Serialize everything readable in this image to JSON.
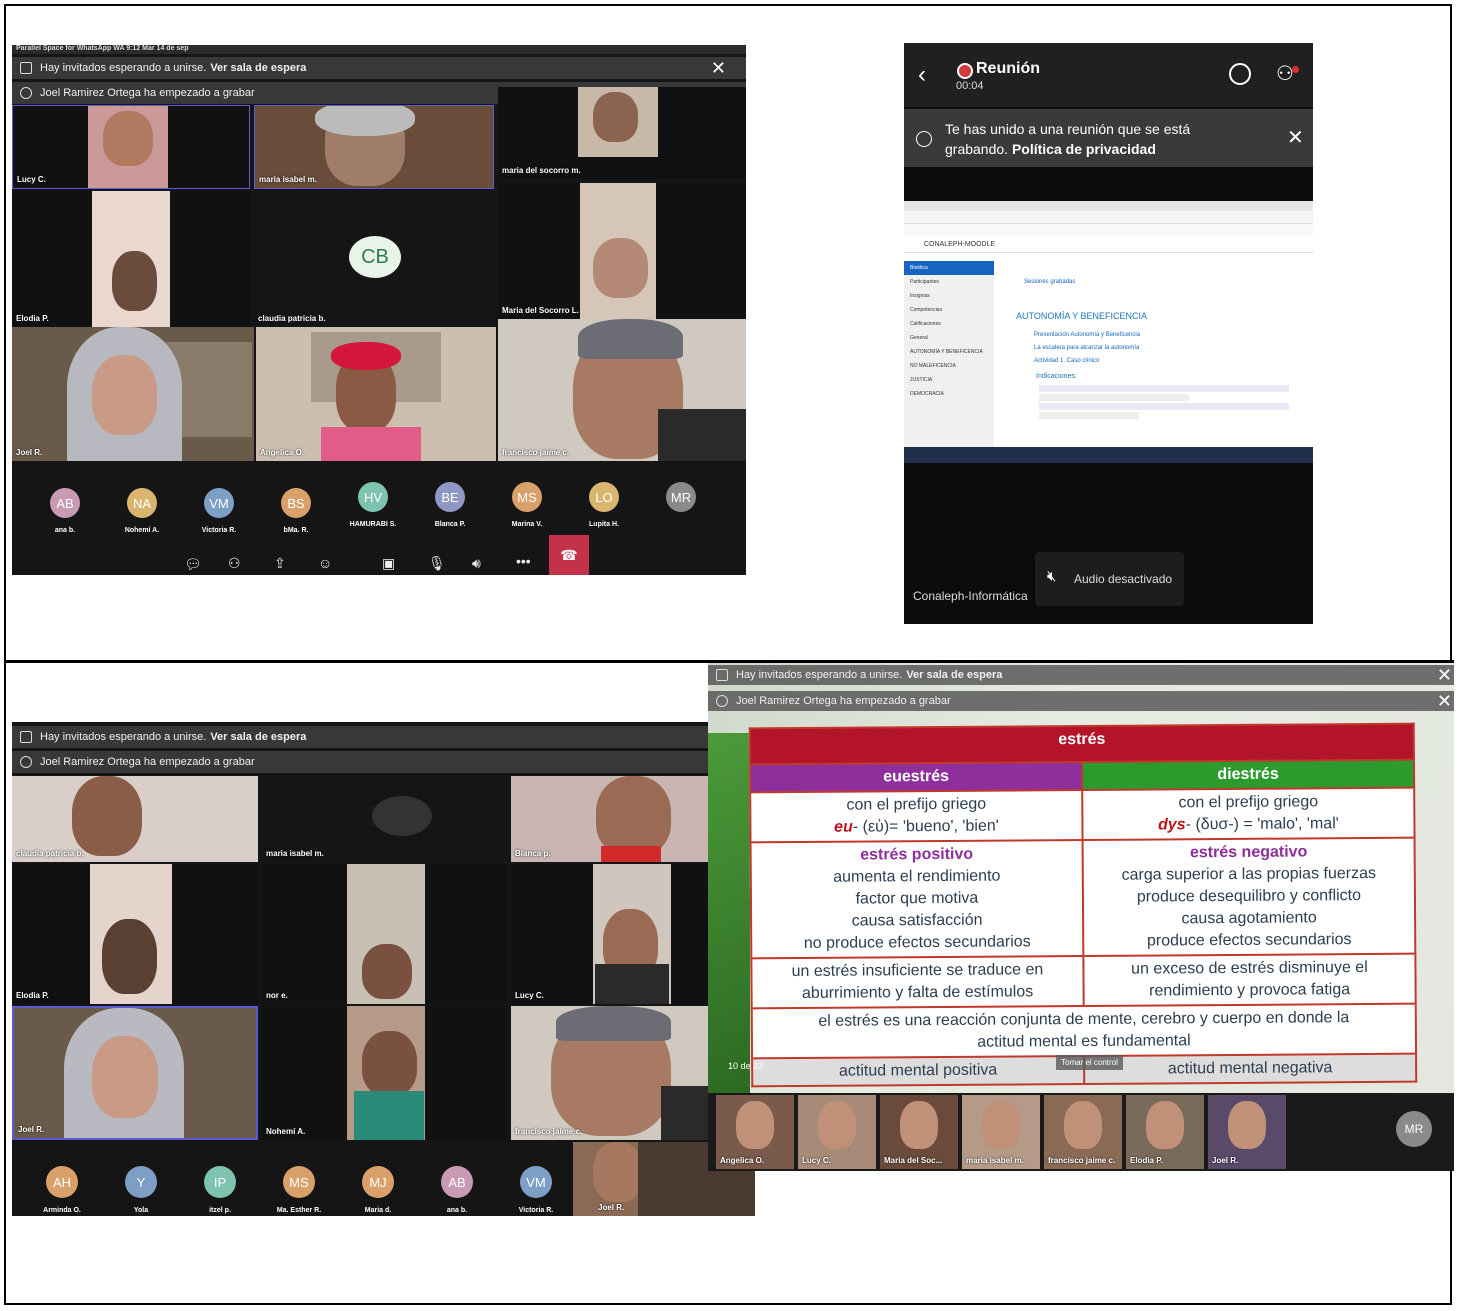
{
  "panel1": {
    "status_bar": "Parallel Space for WhatsApp WA   9:12   Mar 14 de sep",
    "notice_waiting": "Hay invitados esperando a unirse.",
    "notice_waiting_link": "Ver sala de espera",
    "notice_recording": "Joel Ramirez Ortega ha empezado a grabar",
    "tiles": [
      "Lucy C.",
      "maria isabel m.",
      "maria del socorro m.",
      "Elodia P.",
      "claudia patricia b.",
      "Maria del Socorro L.",
      "Joel R.",
      "Angelica O.",
      "francisco jaime c."
    ],
    "center_avatar": "CB",
    "avatars": [
      {
        "initials": "AB",
        "name": "ana b.",
        "color": "#c99ab3"
      },
      {
        "initials": "NA",
        "name": "Nohemí A.",
        "color": "#d9b56f"
      },
      {
        "initials": "VM",
        "name": "Victoria R.",
        "color": "#7d9fc6"
      },
      {
        "initials": "BS",
        "name": "bMa. R.",
        "color": "#d9a06a"
      },
      {
        "initials": "HV",
        "name": "HAMURABI S.",
        "color": "#7ec2b0"
      },
      {
        "initials": "BE",
        "name": "Blanca P.",
        "color": "#8f97c4"
      },
      {
        "initials": "MS",
        "name": "Marina V.",
        "color": "#d9a06a"
      },
      {
        "initials": "LO",
        "name": "Lupita H.",
        "color": "#d9b56f"
      },
      {
        "initials": "MR",
        "name": "",
        "color": "#8a8a8a"
      }
    ]
  },
  "panel2": {
    "title": "Reunión",
    "timer": "00:04",
    "banner_text": "Te has unido a una reunión que se está grabando.",
    "banner_link": "Política de privacidad",
    "moodle_header": "CONALEPH-MOODLE",
    "moodle_sidebar": [
      "Bioética",
      "Participantes",
      "Insignias",
      "Competencias",
      "Calificaciones",
      "General",
      "AUTONOMÍA Y BENEFICENCIA",
      "NO MALEFICENCIA",
      "JUSTICIA",
      "DEMOCRACIA"
    ],
    "moodle_section_link": "Sesiones grabadas",
    "moodle_section_title": "AUTONOMÍA Y BENEFICENCIA",
    "moodle_items": [
      "Presentación Autonomía y Beneficencia",
      "La escalera para alcanzar la autonomía",
      "Actividad 1. Caso clínico"
    ],
    "moodle_indications": "Indicaciones:",
    "audio_off": "Audio desactivado",
    "presenter": "Conaleph-Informática"
  },
  "panel3": {
    "notice_waiting": "Hay invitados esperando a unirse.",
    "notice_waiting_link": "Ver sala de espera",
    "notice_recording": "Joel Ramirez Ortega ha empezado a grabar",
    "tiles": [
      "claudia patricia b.",
      "maria isabel m.",
      "Blanca p.",
      "Elodia P.",
      "nor e.",
      "Lucy C.",
      "Joel R.",
      "Nohemí A.",
      "francisco jaime c."
    ],
    "avatars": [
      {
        "initials": "AH",
        "name": "Arminda O.",
        "color": "#d9a06a"
      },
      {
        "initials": "Y",
        "name": "Yola",
        "color": "#7d9fc6"
      },
      {
        "initials": "IP",
        "name": "itzel p.",
        "color": "#7ec2b0"
      },
      {
        "initials": "MS",
        "name": "Ma. Esther R.",
        "color": "#d9a06a"
      },
      {
        "initials": "MJ",
        "name": "Maria d.",
        "color": "#d9a06a"
      },
      {
        "initials": "AB",
        "name": "ana b.",
        "color": "#c99ab3"
      },
      {
        "initials": "VM",
        "name": "Victoria R.",
        "color": "#7d9fc6"
      }
    ],
    "video_thumb": "Joel R."
  },
  "panel4": {
    "notice_waiting": "Hay invitados esperando a unirse.",
    "notice_waiting_link": "Ver sala de espera",
    "notice_recording": "Joel Ramirez Ortega ha empezado a grabar",
    "slide": {
      "title": "estrés",
      "col_left": "euestrés",
      "col_right": "diestrés",
      "prefix_left_1": "con el prefijo griego",
      "prefix_left_2a": "eu",
      "prefix_left_2b": "- (εὐ)= 'bueno', 'bien'",
      "prefix_right_1": "con el prefijo griego",
      "prefix_right_2a": "dys",
      "prefix_right_2b": "- (δυσ-) = 'malo', 'mal'",
      "left_heading": "estrés positivo",
      "left_lines": [
        "aumenta el rendimiento",
        "factor que motiva",
        "causa satisfacción",
        "no produce efectos secundarios"
      ],
      "right_heading": "estrés negativo",
      "right_lines": [
        "carga superior a las propias fuerzas",
        "produce desequilibro y conflicto",
        "causa agotamiento",
        "produce efectos secundarios"
      ],
      "left_summary": "un estrés insuficiente se traduce en aburrimiento y falta de estímulos",
      "right_summary": "un exceso de estrés disminuye el rendimiento y provoca fatiga",
      "conclusion": "el estrés es una reacción conjunta de mente, cerebro y cuerpo en donde la actitud mental es fundamental",
      "bottom_left": "actitud mental positiva",
      "bottom_right": "actitud mental negativa",
      "page": "10 de 23",
      "control": "Tomar el control"
    },
    "thumbs": [
      "Angelica O.",
      "Lucy C.",
      "Maria del Soc...",
      "maria isabel m.",
      "francisco jaime c.",
      "Elodia P.",
      "Joel R."
    ],
    "avatar": "MR"
  }
}
